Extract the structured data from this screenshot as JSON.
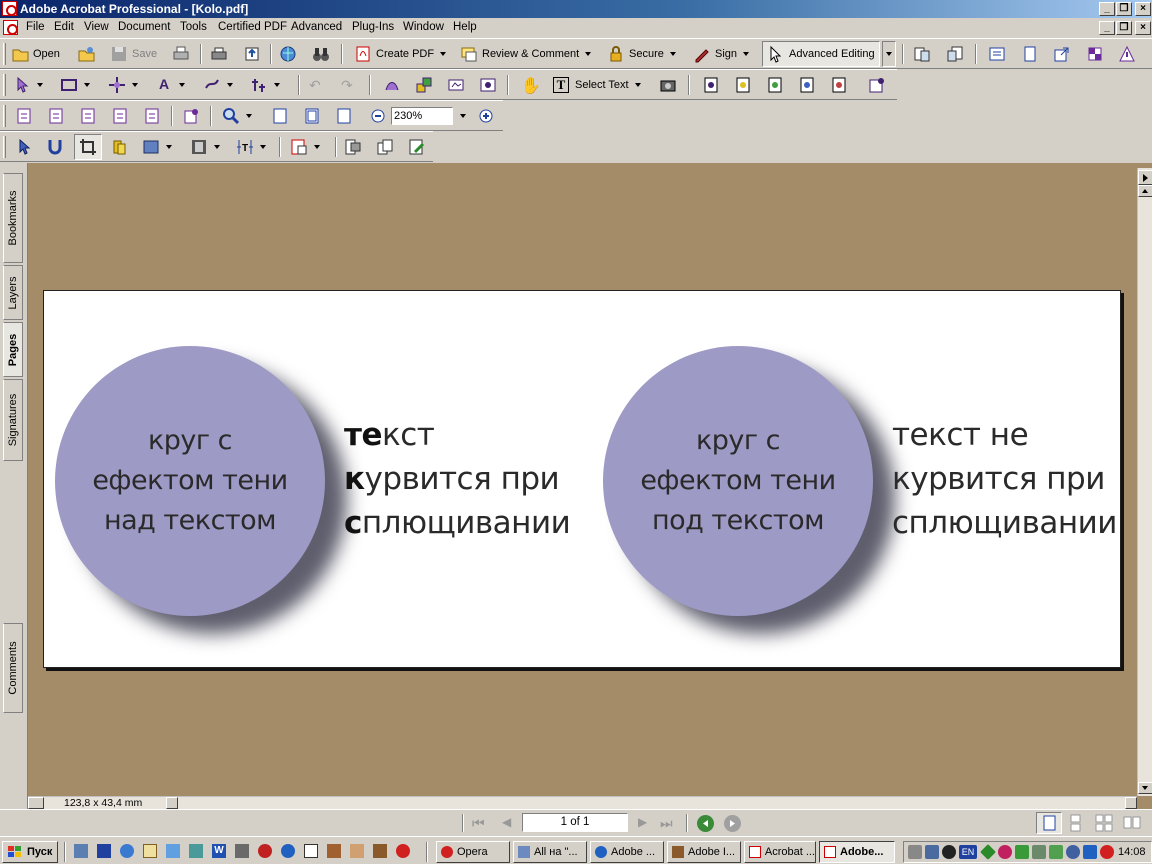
{
  "window": {
    "title": "Adobe Acrobat Professional - [Kolo.pdf]"
  },
  "menu": [
    "File",
    "Edit",
    "View",
    "Document",
    "Tools",
    "Certified PDF",
    "Advanced",
    "Plug-Ins",
    "Window",
    "Help"
  ],
  "toolbar1": {
    "open": "Open",
    "save": "Save",
    "create_pdf": "Create PDF",
    "review": "Review & Comment",
    "secure": "Secure",
    "sign": "Sign",
    "advanced_editing": "Advanced Editing"
  },
  "toolbar2": {
    "select_text": "Select Text"
  },
  "toolbar3": {
    "zoom": "230%"
  },
  "nav_tabs": [
    "Bookmarks",
    "Layers",
    "Pages",
    "Signatures",
    "Comments"
  ],
  "document": {
    "left_circle": [
      "круг с",
      "ефектом тени",
      "над текстом"
    ],
    "left_text": [
      {
        "first": "те",
        "rest": "кст"
      },
      {
        "first": "к",
        "rest": "урвится при"
      },
      {
        "first": "с",
        "rest": "плющивании"
      }
    ],
    "right_circle": [
      "круг с",
      "ефектом тени",
      "под текстом"
    ],
    "right_text": [
      "текст не",
      "курвится при",
      "сплющивании"
    ]
  },
  "status": {
    "page_size": "123,8 x 43,4 mm",
    "page_indicator": "1 of 1"
  },
  "taskbar": {
    "start": "Пуск",
    "tasks": [
      "Opera",
      "All на \"...",
      "Adobe ...",
      "Adobe I...",
      "Acrobat ...",
      "Adobe..."
    ],
    "active_task_index": 5,
    "lang": "EN",
    "clock": "14:08"
  },
  "colors": {
    "circle": "#9d9ac6",
    "workspace": "#a38c67",
    "titlebar": "#0a246a"
  }
}
